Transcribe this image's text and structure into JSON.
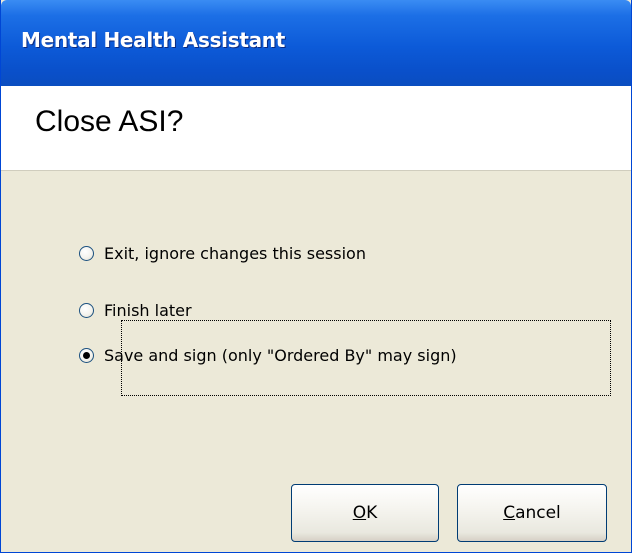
{
  "window": {
    "title": "Mental Health Assistant"
  },
  "header": {
    "title": "Close ASI?"
  },
  "options": [
    {
      "label": "Exit, ignore changes this session",
      "checked": false
    },
    {
      "label": "Finish later",
      "checked": false
    },
    {
      "label": "Save and sign (only \"Ordered By\" may sign)",
      "checked": true
    }
  ],
  "buttons": {
    "ok": {
      "mnemonic": "O",
      "rest": "K"
    },
    "cancel": {
      "mnemonic": "C",
      "rest": "ancel"
    }
  },
  "colors": {
    "titlebar": "#0a54d0",
    "dialog_background": "#ece9d8",
    "header_background": "#ffffff",
    "button_border": "#003c74"
  }
}
